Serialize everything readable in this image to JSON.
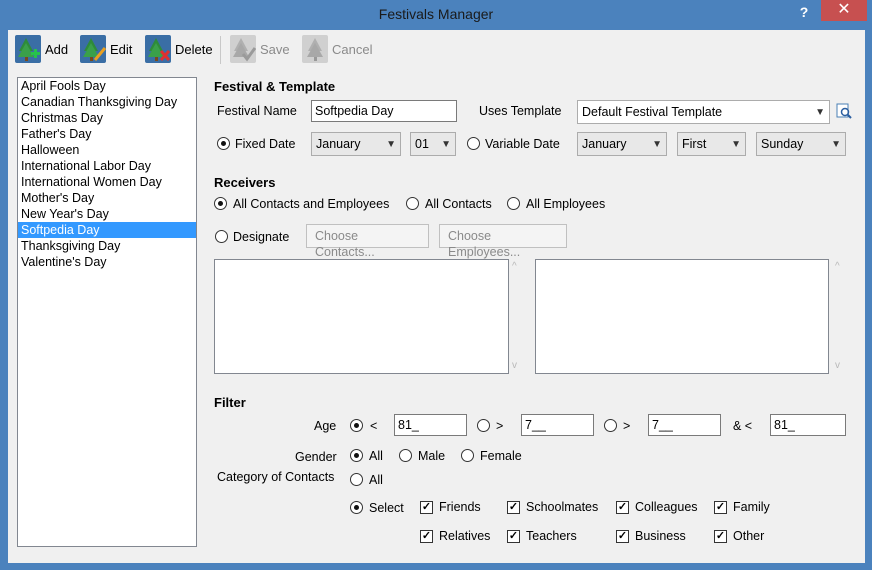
{
  "window": {
    "title": "Festivals Manager",
    "help": "?",
    "close": "✕"
  },
  "toolbar": {
    "add": "Add",
    "edit": "Edit",
    "delete": "Delete",
    "save": "Save",
    "cancel": "Cancel"
  },
  "festivals": {
    "items": [
      "April Fools Day",
      "Canadian Thanksgiving Day",
      "Christmas Day",
      "Father's Day",
      "Halloween",
      "International Labor Day",
      "International Women Day",
      "Mother's Day",
      "New Year's Day",
      "Softpedia Day",
      "Thanksgiving Day",
      "Valentine's Day"
    ],
    "selected": "Softpedia Day"
  },
  "festival_template": {
    "title": "Festival & Template",
    "name_label": "Festival Name",
    "name_value": "Softpedia Day",
    "uses_template_label": "Uses Template",
    "template_value": "Default Festival Template",
    "fixed_date_label": "Fixed Date",
    "fixed_month": "January",
    "fixed_day": "01",
    "variable_date_label": "Variable Date",
    "var_month": "January",
    "var_week": "First",
    "var_weekday": "Sunday"
  },
  "receivers": {
    "title": "Receivers",
    "all_contacts_employees": "All Contacts and Employees",
    "all_contacts": "All Contacts",
    "all_employees": "All Employees",
    "designate": "Designate",
    "choose_contacts": "Choose Contacts...",
    "choose_employees": "Choose Employees..."
  },
  "filter": {
    "title": "Filter",
    "age_label": "Age",
    "lt_symbol": "<",
    "gt_symbol": ">",
    "and_lt": "& <",
    "age_lt_value": "81_",
    "age_gt_value": "7__",
    "age_gt2_value": "7__",
    "age_and_lt_value": "81_",
    "gender_label": "Gender",
    "gender_all": "All",
    "gender_male": "Male",
    "gender_female": "Female",
    "category_label": "Category of Contacts",
    "cat_all": "All",
    "cat_select": "Select",
    "categories": [
      "Friends",
      "Schoolmates",
      "Colleagues",
      "Family",
      "Relatives",
      "Teachers",
      "Business",
      "Other"
    ]
  },
  "colors": {
    "selection": "#3399ff",
    "close": "#c75050",
    "frame": "#4b82bd"
  }
}
